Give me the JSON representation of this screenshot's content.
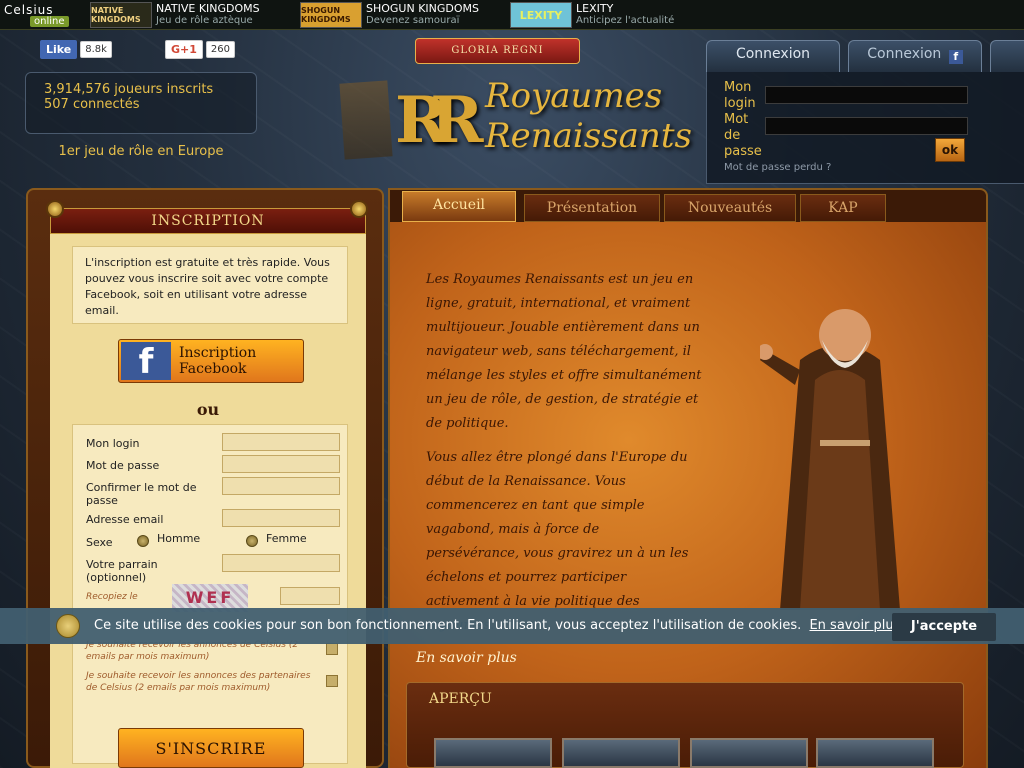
{
  "topbar": {
    "celsius_line1": "Celsius",
    "celsius_line2": "online",
    "games": [
      {
        "logo": "NATIVE KINGDOMS",
        "title": "NATIVE KINGDOMS",
        "subtitle": "Jeu de rôle aztèque"
      },
      {
        "logo": "SHOGUN KINGDOMS",
        "title": "SHOGUN KINGDOMS",
        "subtitle": "Devenez samouraï"
      },
      {
        "logo": "LEXITY",
        "title": "LEXITY",
        "subtitle": "Anticipez l'actualité"
      }
    ]
  },
  "social": {
    "fb_label": "Like",
    "fb_count": "8.8k",
    "gplus_label": "G+1",
    "gplus_count": "260"
  },
  "stats": {
    "players": "3,914,576 joueurs inscrits",
    "online": "507 connectés",
    "tagline": "1er jeu de rôle en Europe"
  },
  "logo": {
    "banner": "GLORIA REGNI",
    "initials": "RR",
    "title_line1": "Royaumes",
    "title_line2": "Renaissants"
  },
  "login": {
    "tab_connexion": "Connexion",
    "tab_connexion_fb": "Connexion",
    "login_label_1": "Mon",
    "login_label_2": "login",
    "password_label_1": "Mot",
    "password_label_2": "de",
    "password_label_3": "passe",
    "ok_label": "ok",
    "lost_password": "Mot de passe perdu ?"
  },
  "inscription": {
    "header": "INSCRIPTION",
    "intro": "L'inscription est gratuite et très rapide. Vous pouvez vous inscrire soit avec votre compte Facebook, soit en utilisant votre adresse email.",
    "fb_line1": "Inscription",
    "fb_line2": "Facebook",
    "or": "ou",
    "fields": {
      "login": "Mon login",
      "password": "Mot de passe",
      "confirm": "Confirmer le mot de passe",
      "email": "Adresse email",
      "sex": "Sexe",
      "male": "Homme",
      "female": "Femme",
      "sponsor": "Votre parrain (optionnel)",
      "captcha_label": "Recopiez le",
      "captcha_text": "WEF"
    },
    "opt_celsius": "Je souhaite recevoir les annonces de Celsius (2 emails par mois maximum)",
    "opt_partners": "Je souhaite recevoir les annonces des partenaires de Celsius (2 emails par mois maximum)",
    "submit": "S'INSCRIRE"
  },
  "main": {
    "tabs": [
      "Accueil",
      "Présentation",
      "Nouveautés",
      "KAP"
    ],
    "paragraph1": "Les Royaumes Renaissants est un jeu en ligne, gratuit, international, et vraiment multijoueur. Jouable entièrement dans un navigateur web, sans téléchargement, il mélange les styles et offre simultanément un jeu de rôle, de gestion, de stratégie et de politique.",
    "paragraph2": "Vous allez être plongé dans l'Europe du début de la Renaissance. Vous commencerez en tant que simple vagabond, mais à force de persévérance, vous gravirez un à un les échelons et pourrez participer activement à la vie politique des royaumes.",
    "more": "En savoir plus",
    "apercu": "APERÇU"
  },
  "cookie": {
    "message": "Ce site utilise des cookies pour son bon fonctionnement. En l'utilisant, vous acceptez l'utilisation de cookies.",
    "more": "En savoir plus.",
    "accept": "J'accepte"
  }
}
